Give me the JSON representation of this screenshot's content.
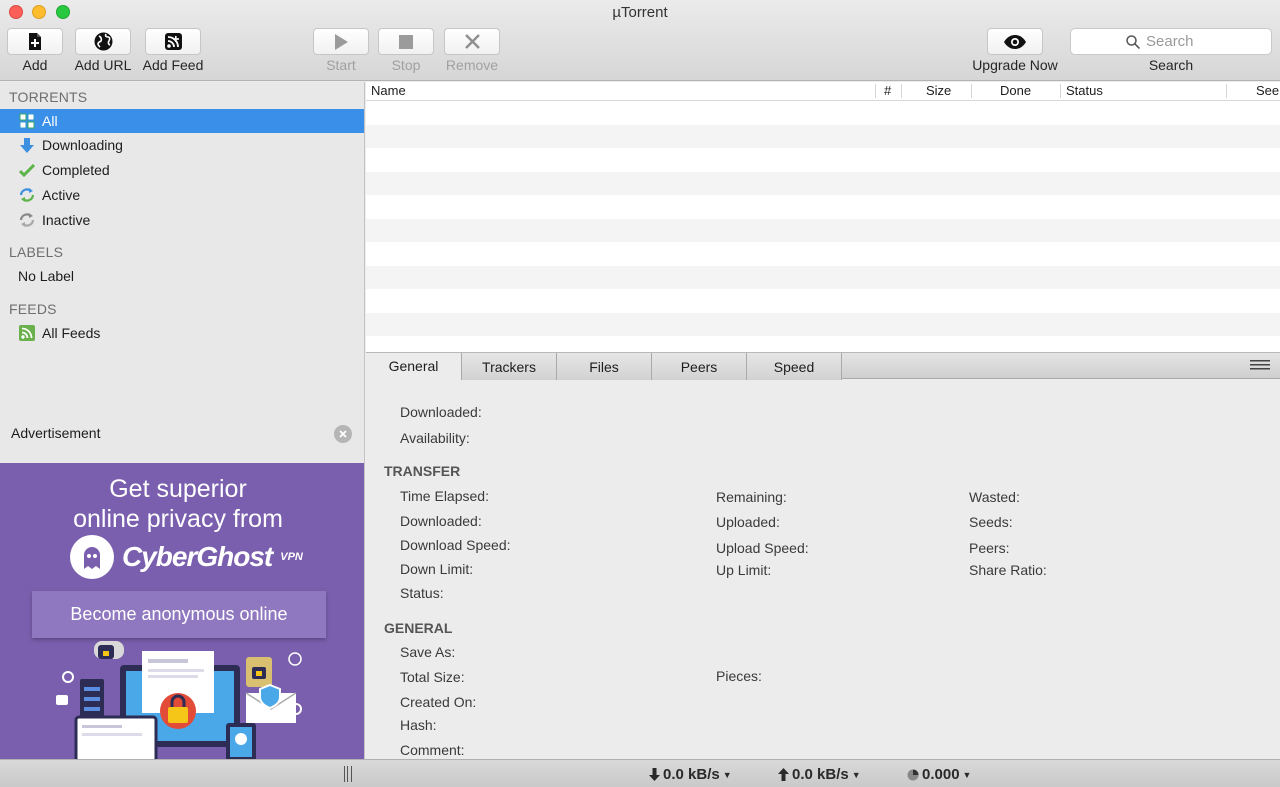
{
  "window": {
    "title": "µTorrent"
  },
  "toolbar": {
    "add": "Add",
    "add_url": "Add URL",
    "add_feed": "Add Feed",
    "start": "Start",
    "stop": "Stop",
    "remove": "Remove",
    "upgrade": "Upgrade Now",
    "search_placeholder": "Search",
    "search_label": "Search"
  },
  "sidebar": {
    "torrents_heading": "TORRENTS",
    "torrents": [
      {
        "label": "All",
        "icon": "all-torrents-icon"
      },
      {
        "label": "Downloading",
        "icon": "download-arrow-icon"
      },
      {
        "label": "Completed",
        "icon": "checkmark-icon"
      },
      {
        "label": "Active",
        "icon": "active-arrows-icon"
      },
      {
        "label": "Inactive",
        "icon": "inactive-arrows-icon"
      }
    ],
    "labels_heading": "LABELS",
    "labels": [
      {
        "label": "No Label"
      }
    ],
    "feeds_heading": "FEEDS",
    "feeds": [
      {
        "label": "All Feeds",
        "icon": "rss-icon"
      }
    ]
  },
  "advertisement": {
    "label": "Advertisement",
    "headline_line1": "Get superior",
    "headline_line2": "online privacy from",
    "brand": "CyberGhost",
    "brand_suffix": "VPN",
    "cta": "Become anonymous online",
    "colors": {
      "background": "#7a5fae",
      "cta_background": "#8f78bf"
    }
  },
  "torrent_list": {
    "columns": [
      "Name",
      "#",
      "Size",
      "Done",
      "Status",
      "See"
    ],
    "rows": []
  },
  "detail": {
    "tabs": [
      "General",
      "Trackers",
      "Files",
      "Peers",
      "Speed"
    ],
    "active_tab": "General",
    "top_fields": [
      "Downloaded:",
      "Availability:"
    ],
    "transfer_heading": "TRANSFER",
    "transfer_col1": [
      "Time Elapsed:",
      "Downloaded:",
      "Download Speed:",
      "Down Limit:",
      "Status:"
    ],
    "transfer_col2": [
      "Remaining:",
      "Uploaded:",
      "Upload Speed:",
      "Up Limit:"
    ],
    "transfer_col3": [
      "Wasted:",
      "Seeds:",
      "Peers:",
      "Share Ratio:"
    ],
    "general_heading": "GENERAL",
    "general_col1": [
      "Save As:",
      "Total Size:",
      "Created On:",
      "Hash:",
      "Comment:"
    ],
    "general_col2": [
      "Pieces:"
    ]
  },
  "statusbar": {
    "download_rate": "0.0 kB/s",
    "upload_rate": "0.0 kB/s",
    "ratio": "0.000"
  },
  "colors": {
    "selection": "#3a8fe9"
  }
}
